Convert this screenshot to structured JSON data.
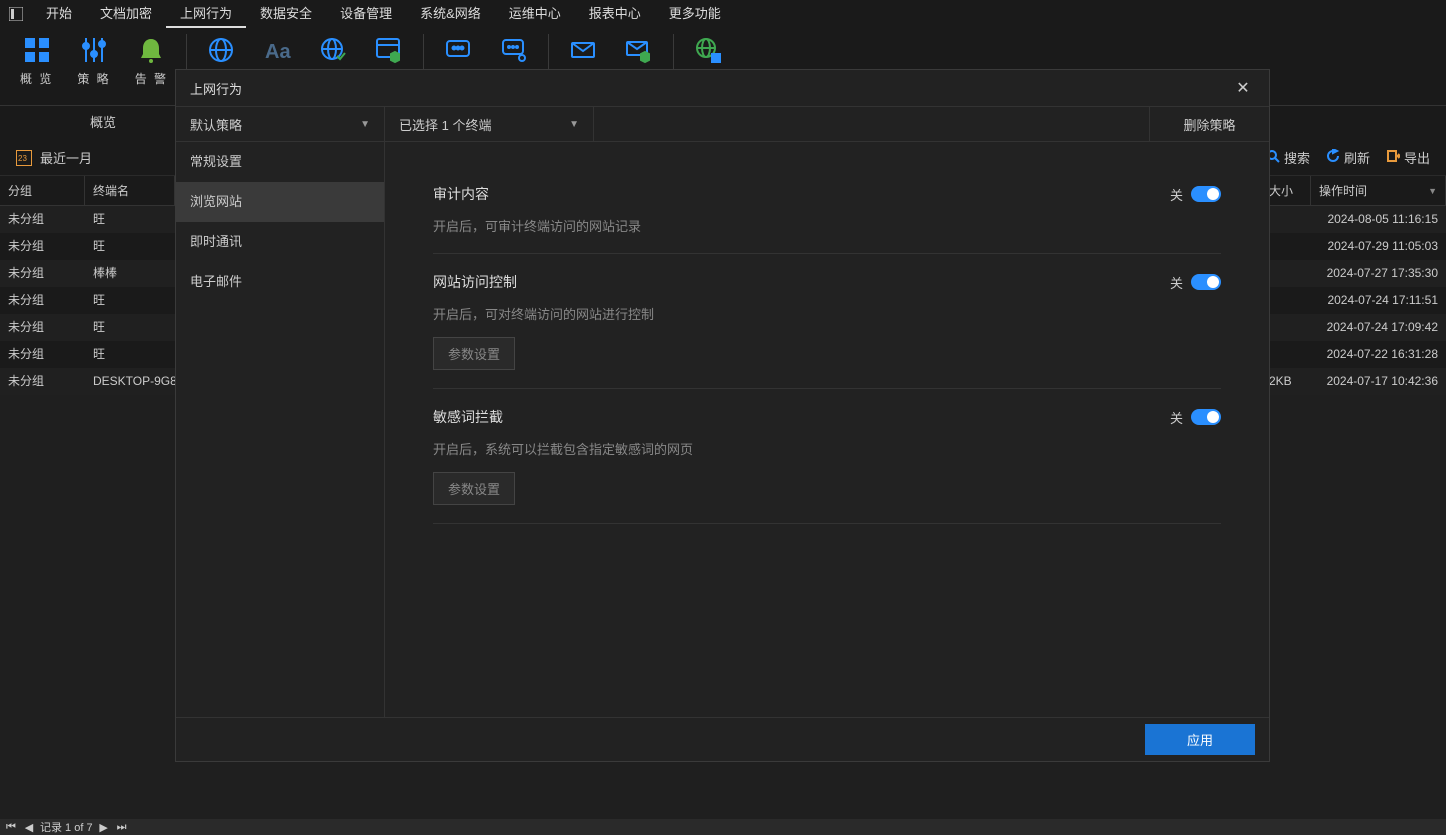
{
  "menubar": {
    "items": [
      "开始",
      "文档加密",
      "上网行为",
      "数据安全",
      "设备管理",
      "系统&网络",
      "运维中心",
      "报表中心",
      "更多功能"
    ],
    "active": 2
  },
  "ribbon": {
    "items": [
      {
        "label": "概 览"
      },
      {
        "label": "策 略"
      },
      {
        "label": "告 警"
      }
    ]
  },
  "section": {
    "title": "概览"
  },
  "filter": {
    "period": "最近一月",
    "search": "搜索",
    "refresh": "刷新",
    "export": "导出"
  },
  "table": {
    "headers": {
      "group": "分组",
      "terminal": "终端名",
      "size": "大小",
      "optime": "操作时间"
    },
    "rows": [
      {
        "group": "未分组",
        "terminal": "旺",
        "size": "",
        "time": "2024-08-05 11:16:15"
      },
      {
        "group": "未分组",
        "terminal": "旺",
        "size": "",
        "time": "2024-07-29 11:05:03"
      },
      {
        "group": "未分组",
        "terminal": "棒棒",
        "size": "",
        "time": "2024-07-27 17:35:30"
      },
      {
        "group": "未分组",
        "terminal": "旺",
        "size": "",
        "time": "2024-07-24 17:11:51"
      },
      {
        "group": "未分组",
        "terminal": "旺",
        "size": "",
        "time": "2024-07-24 17:09:42"
      },
      {
        "group": "未分组",
        "terminal": "旺",
        "size": "",
        "time": "2024-07-22 16:31:28"
      },
      {
        "group": "未分组",
        "terminal": "DESKTOP-9G8",
        "size": "2KB",
        "time": "2024-07-17 10:42:36"
      }
    ]
  },
  "statusbar": {
    "record": "记录 1 of 7"
  },
  "modal": {
    "title": "上网行为",
    "policy": "默认策略",
    "terminals": "已选择 1 个终端",
    "delete": "删除策略",
    "sidebar": [
      "常规设置",
      "浏览网站",
      "即时通讯",
      "电子邮件"
    ],
    "sidebar_active": 1,
    "settings": [
      {
        "title": "审计内容",
        "desc": "开启后，可审计终端访问的网站记录",
        "toggle": "关",
        "param": null
      },
      {
        "title": "网站访问控制",
        "desc": "开启后，可对终端访问的网站进行控制",
        "toggle": "关",
        "param": "参数设置"
      },
      {
        "title": "敏感词拦截",
        "desc": "开启后，系统可以拦截包含指定敏感词的网页",
        "toggle": "关",
        "param": "参数设置"
      }
    ],
    "apply": "应用"
  }
}
